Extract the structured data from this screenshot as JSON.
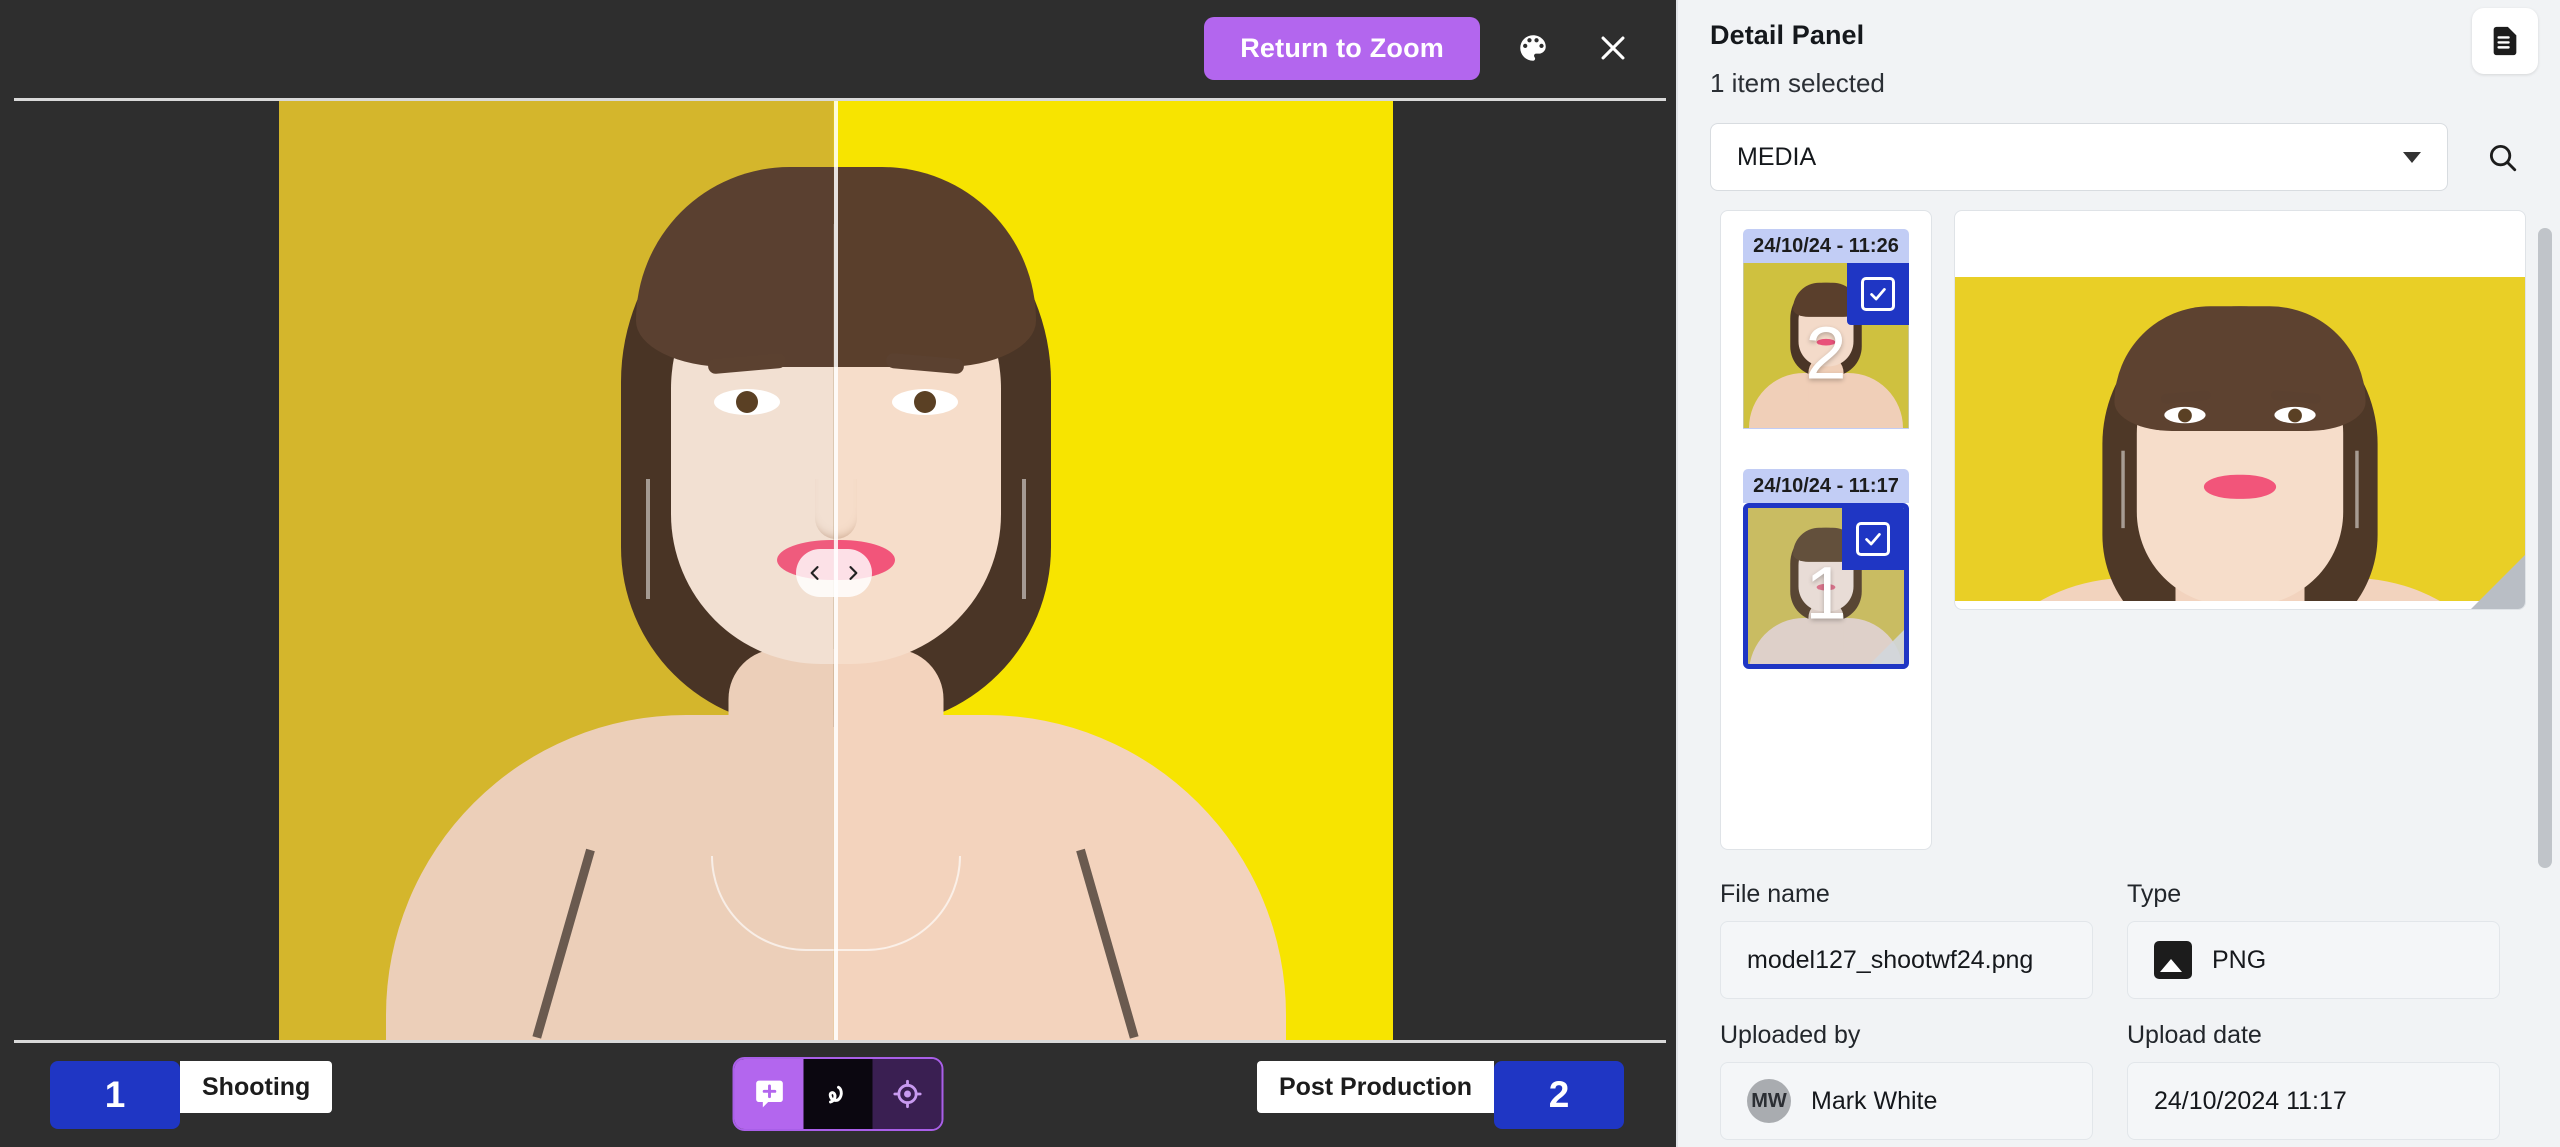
{
  "viewer": {
    "return_button": "Return to Zoom",
    "palette_icon": "palette-icon",
    "close_icon": "close-icon",
    "prev_icon": "chevron-left-icon",
    "next_icon": "chevron-right-icon"
  },
  "workflow": {
    "left_phase_number": "1",
    "left_phase_label": "Shooting",
    "right_phase_number": "2",
    "right_phase_label": "Post Production",
    "tools": [
      {
        "name": "add-comment-icon",
        "color": "#b366ee"
      },
      {
        "name": "freehand-draw-icon",
        "color": "#0b0710"
      },
      {
        "name": "focus-target-icon",
        "color": "#3a1f52"
      }
    ]
  },
  "detail_panel": {
    "title": "Detail Panel",
    "selection_status": "1 item selected",
    "document_icon": "document-icon",
    "category_select": {
      "value": "MEDIA",
      "caret_icon": "chevron-down-icon"
    },
    "search_icon": "search-icon",
    "thumbnails": [
      {
        "date": "24/10/24 - 11:26",
        "index": "2",
        "selected": false,
        "checked": true
      },
      {
        "date": "24/10/24 - 11:17",
        "index": "1",
        "selected": true,
        "checked": true
      }
    ],
    "metadata": [
      {
        "label": "File name",
        "value": "model127_shootwf24.png",
        "icon": null
      },
      {
        "label": "Type",
        "value": "PNG",
        "icon": "image-file-icon"
      },
      {
        "label": "Uploaded by",
        "value": "Mark White",
        "icon": "avatar",
        "initials": "MW"
      },
      {
        "label": "Upload date",
        "value": "24/10/2024 11:17",
        "icon": null
      }
    ]
  },
  "colors": {
    "accent_purple": "#b366ee",
    "accent_blue": "#1f36c4",
    "panel_bg": "#f1f3f5",
    "viewer_bg": "#2e2e2e",
    "after_yellow": "#f7e400",
    "before_yellow": "#d4b62c"
  }
}
